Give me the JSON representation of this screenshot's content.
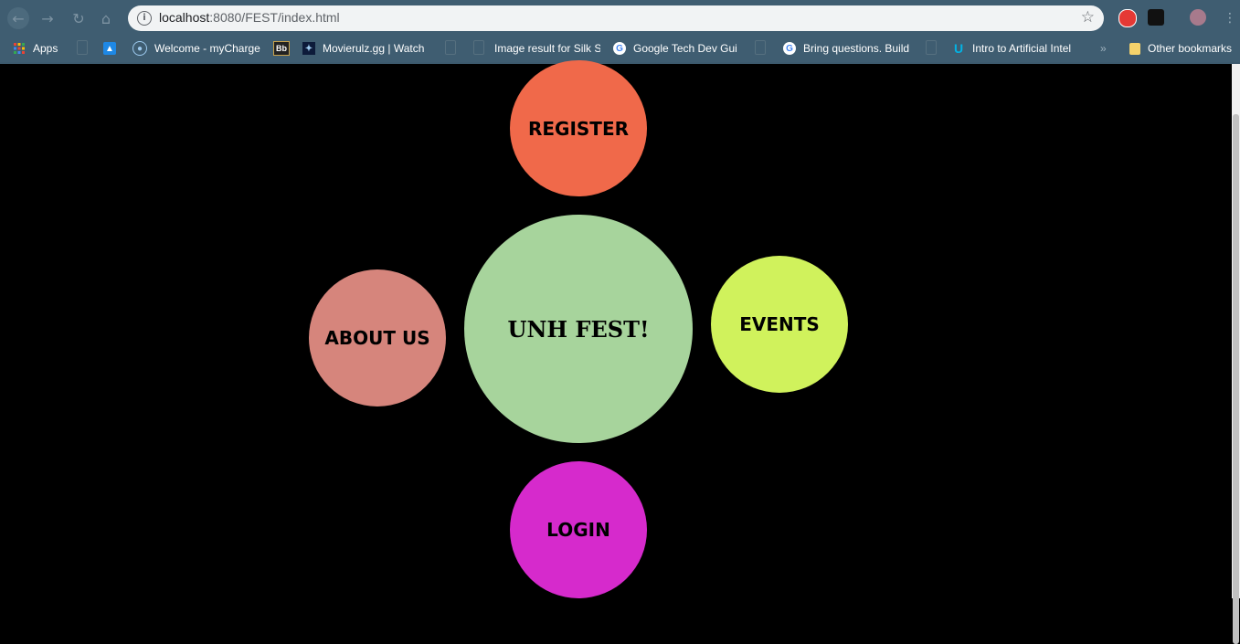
{
  "browser": {
    "url_host": "localhost",
    "url_path": ":8080/FEST/index.html",
    "bookmarks": [
      {
        "label": "Apps",
        "icon": "apps-grid-icon"
      },
      {
        "label": "Welcome - myCharge",
        "icon": "globe-icon"
      },
      {
        "label": "Movierulz.gg | Watch",
        "icon": "movie-icon"
      },
      {
        "label": "Image result for Silk S",
        "icon": "page-icon"
      },
      {
        "label": "Google Tech Dev Gui",
        "icon": "google-icon"
      },
      {
        "label": "Bring questions. Build",
        "icon": "google-icon"
      },
      {
        "label": "Intro to Artificial Intel",
        "icon": "udacity-icon"
      },
      {
        "label": "Other bookmarks",
        "icon": "folder-icon"
      }
    ],
    "bb_badge": "Bb",
    "overflow": "»"
  },
  "page": {
    "center_title": "UNH FEST!",
    "nav": {
      "register": "REGISTER",
      "about": "ABOUT US",
      "events": "EVENTS",
      "login": "LOGIN"
    }
  },
  "colors": {
    "background": "#000000",
    "register": "#f0694a",
    "about": "#d6857c",
    "center": "#a7d49c",
    "events": "#d0f25c",
    "login": "#d62acc"
  }
}
